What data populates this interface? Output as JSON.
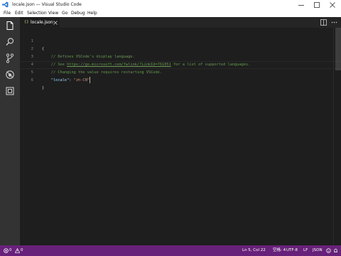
{
  "window": {
    "title": "locale.json — Visual Studio Code"
  },
  "menu": {
    "items": [
      "File",
      "Edit",
      "Selection",
      "View",
      "Go",
      "Debug",
      "Help"
    ]
  },
  "activity_bar": {
    "icons": [
      "files-icon",
      "search-icon",
      "source-control-icon",
      "debug-icon",
      "extensions-icon"
    ]
  },
  "tab": {
    "icon_text": "{}",
    "label": "locale.json"
  },
  "editor": {
    "line_numbers": [
      "1",
      "2",
      "3",
      "4",
      "5",
      "6"
    ],
    "line1": "{",
    "line2": "// Defines VSCode's display language.",
    "line3_prefix": "// See ",
    "line3_link": "https://go.microsoft.com/fwlink/?LinkId=761051",
    "line3_suffix": " for a list of supported languages.",
    "line4": "// Changing the value requires restarting VSCode.",
    "line5_key": "\"locale\"",
    "line5_colon": ": ",
    "line5_value": "\"zh-CN\"",
    "line6": "}"
  },
  "status": {
    "errors": "0",
    "warnings": "0",
    "position": "Ln 5, Col 22",
    "indent": "空格: 4",
    "encoding": "UTF-8",
    "eol": "LF",
    "language": "JSON"
  },
  "colors": {
    "status_bar": "#68217a",
    "activity_bar": "#333333",
    "editor_bg": "#1e1e1e",
    "comment": "#6a9955",
    "json_key": "#9cdcfe",
    "string": "#ce9178"
  }
}
